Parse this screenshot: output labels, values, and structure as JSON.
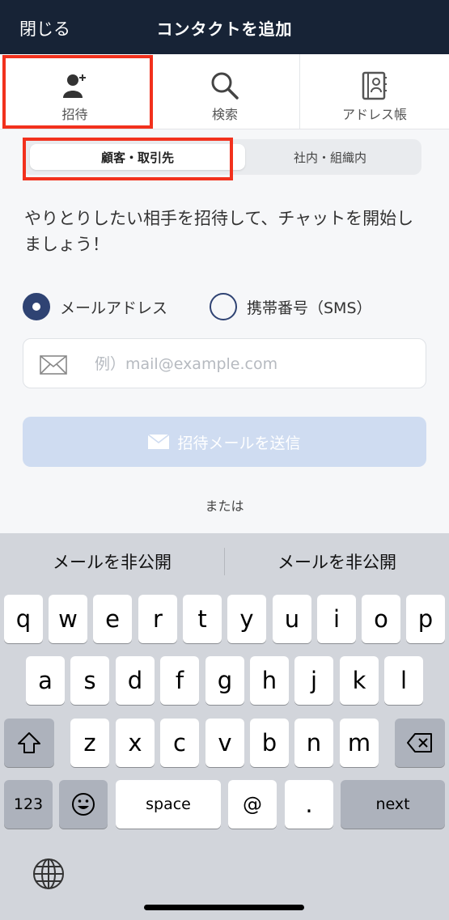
{
  "header": {
    "close_label": "閉じる",
    "title": "コンタクトを追加"
  },
  "top_tabs": [
    {
      "label": "招待",
      "icon": "add-person-icon"
    },
    {
      "label": "検索",
      "icon": "search-icon"
    },
    {
      "label": "アドレス帳",
      "icon": "address-book-icon"
    }
  ],
  "segment": {
    "active": "顧客・取引先",
    "inactive": "社内・組織内"
  },
  "description": "やりとりしたい相手を招待して、チャットを開始しましょう！",
  "radios": {
    "email_label": "メールアドレス",
    "sms_label": "携帯番号（SMS）",
    "selected": "email"
  },
  "email_input": {
    "placeholder": "例）mail@example.com",
    "value": ""
  },
  "send_button": {
    "label": "招待メールを送信"
  },
  "or_label": "または",
  "keyboard": {
    "suggestions": [
      "メールを非公開",
      "メールを非公開"
    ],
    "row1": [
      "q",
      "w",
      "e",
      "r",
      "t",
      "y",
      "u",
      "i",
      "o",
      "p"
    ],
    "row2": [
      "a",
      "s",
      "d",
      "f",
      "g",
      "h",
      "j",
      "k",
      "l"
    ],
    "row3": [
      "z",
      "x",
      "c",
      "v",
      "b",
      "n",
      "m"
    ],
    "numbers_label": "123",
    "space_label": "space",
    "at_label": "@",
    "dot_label": ".",
    "next_label": "next"
  },
  "colors": {
    "header_bg": "#172336",
    "accent": "#2f4373",
    "highlight": "#f2311d",
    "button_disabled": "#cfdcf1"
  }
}
